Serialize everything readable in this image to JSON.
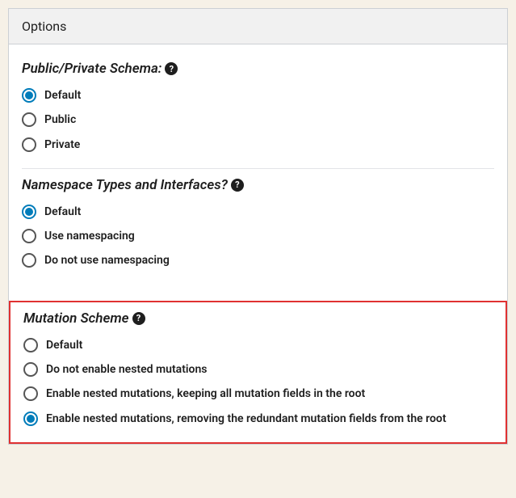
{
  "panel": {
    "title": "Options"
  },
  "sections": {
    "schema": {
      "title": "Public/Private Schema:",
      "options": {
        "0": {
          "label": "Default",
          "selected": true
        },
        "1": {
          "label": "Public",
          "selected": false
        },
        "2": {
          "label": "Private",
          "selected": false
        }
      }
    },
    "namespace": {
      "title": "Namespace Types and Interfaces?",
      "options": {
        "0": {
          "label": "Default",
          "selected": true
        },
        "1": {
          "label": "Use namespacing",
          "selected": false
        },
        "2": {
          "label": "Do not use namespacing",
          "selected": false
        }
      }
    },
    "mutation": {
      "title": "Mutation Scheme",
      "options": {
        "0": {
          "label": "Default",
          "selected": false
        },
        "1": {
          "label": "Do not enable nested mutations",
          "selected": false
        },
        "2": {
          "label": "Enable nested mutations, keeping all mutation fields in the root",
          "selected": false
        },
        "3": {
          "label": "Enable nested mutations, removing the redundant mutation fields from the root",
          "selected": true
        }
      }
    }
  },
  "help_glyph": "?"
}
